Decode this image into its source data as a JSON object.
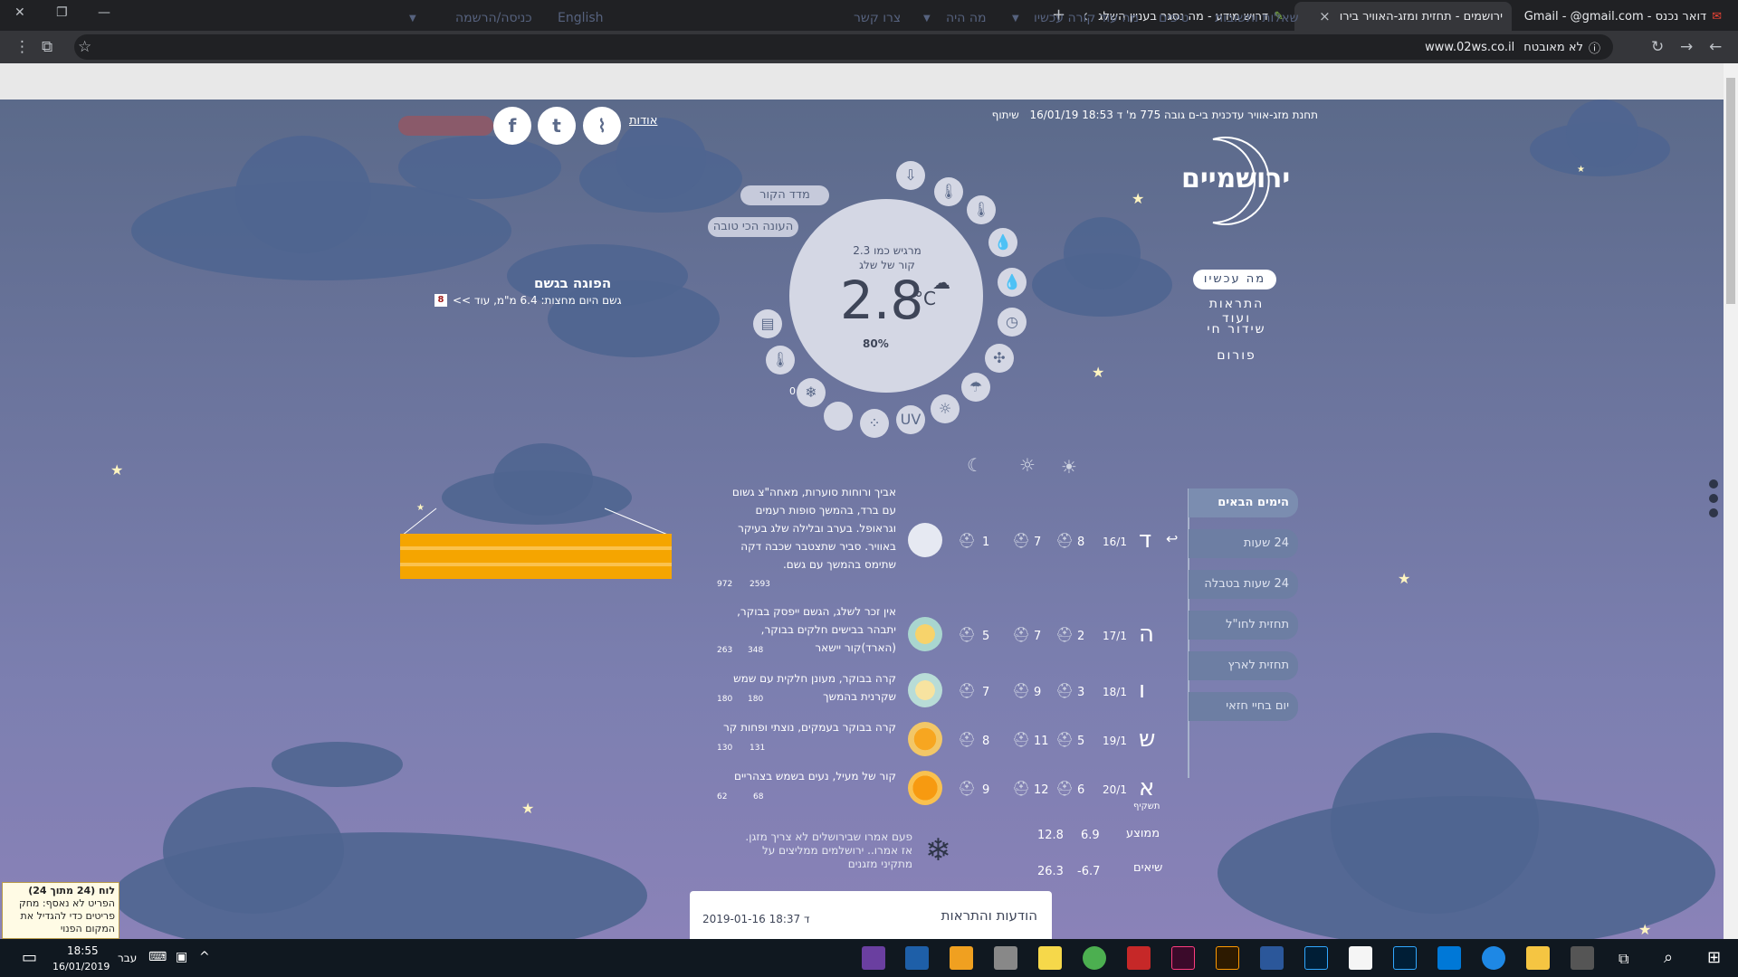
{
  "browser": {
    "tabs": [
      {
        "label": "דואר נכנס - Gmail - ‎@gmail.com"
      },
      {
        "label": "ירושמים - תחזית ומזג-האוויר בירו"
      },
      {
        "label": "דרוש מידע - מה נסגר בעניין השלג"
      }
    ],
    "url": "www.02ws.co.il",
    "security": "לא מאובטח",
    "new_tab": "+"
  },
  "nav": {
    "items": [
      "שאלות ותשובות",
      "טיפים",
      "מה עוד קורה עכשיו",
      "מה היה",
      "צרו קשר",
      "English",
      "כניסה/הרשמה"
    ]
  },
  "header": {
    "station_line": "תחנת מזג-אוויר עדכנית בי-ם   גובה 775 מ'   ד 18:53 16/01/19",
    "share": "שיתוף",
    "logo_text": "ירושמיים",
    "about": "אודות",
    "menu": [
      "מה עכשיו",
      "התראות ועוד",
      "שידור חי",
      "פורום"
    ]
  },
  "current": {
    "feels_like": "מרגיש כמו 2.3",
    "cold_label": "קור של שלג",
    "temperature": "2.8",
    "unit": "°C",
    "humidity": "80%",
    "wind_chill_pill": "מדד הקור",
    "best_season_pill": "העונה הכי טובה",
    "side_zero": "0"
  },
  "rain": {
    "title": "הפוגה בגשם",
    "text": "גשם היום מחצות: 6.4 מ\"מ,  עוד >>",
    "badge": "8"
  },
  "sidebar": {
    "tabs": [
      "הימים הבאים",
      "24 שעות",
      "24 שעות בטבלה",
      "תחזית לחו\"ל",
      "תחזית לארץ",
      "יום בחיי חזאי"
    ]
  },
  "forecast": {
    "rows": [
      {
        "day": "ד",
        "date": "16/1",
        "n1": "8",
        "n2": "7",
        "n3": "1",
        "text": "אביך ורוחות סוערות, מאחה\"צ גשום עם ברד, בהמשך סופות רעמים וגראופל. בערב ובלילה שלג בעיקר באוויר. סביר שתצטבר שכבה דקה שתימס בהמשך עם גשם.",
        "likes1": "2593",
        "likes2": "972"
      },
      {
        "day": "ה",
        "date": "17/1",
        "n1": "2",
        "n2": "7",
        "n3": "5",
        "text": "אין זכר לשלג, הגשם ייפסק בבוקר, יתבהר בבישים חלקים בבוקר, (הארד)קור יישאר",
        "likes1": "348",
        "likes2": "263"
      },
      {
        "day": "ו",
        "date": "18/1",
        "n1": "3",
        "n2": "9",
        "n3": "7",
        "text": "קרה בבוקר, מעונן חלקית עם שמש שקרנית בהמשך",
        "likes1": "180",
        "likes2": "180"
      },
      {
        "day": "ש",
        "date": "19/1",
        "n1": "5",
        "n2": "11",
        "n3": "8",
        "text": "קרה בבוקר בעמקים, נוצתי ופחות קר",
        "likes1": "131",
        "likes2": "130"
      },
      {
        "day": "א",
        "date": "20/1",
        "n1": "6",
        "n2": "12",
        "n3": "9",
        "text": "קור של מעיל, נעים בשמש בצהריים",
        "likes1": "68",
        "likes2": "62"
      }
    ],
    "sunrise_label": "תשקיף",
    "avg_label": "ממוצע",
    "avg_low": "6.9",
    "avg_high": "12.8",
    "record_label": "שיאים",
    "record_low": "-6.7",
    "record_high": "26.3",
    "tip": "פעם אמרו שבירושלים לא צריך מזגן. אז אמרו.. ירושלמים ממליצים על מתקיני מזגנים"
  },
  "bottom_card": {
    "title": "הודעות והתראות",
    "time": "ד 18:37 2019-01-16"
  },
  "sticky": {
    "title": "לוח (24 מתוך 24)",
    "text": "הפריט לא נאסף: מחק פריטים כדי להגדיל את המקום הפנוי"
  },
  "taskbar": {
    "time": "18:55",
    "date": "16/01/2019",
    "lang": "עבר"
  }
}
